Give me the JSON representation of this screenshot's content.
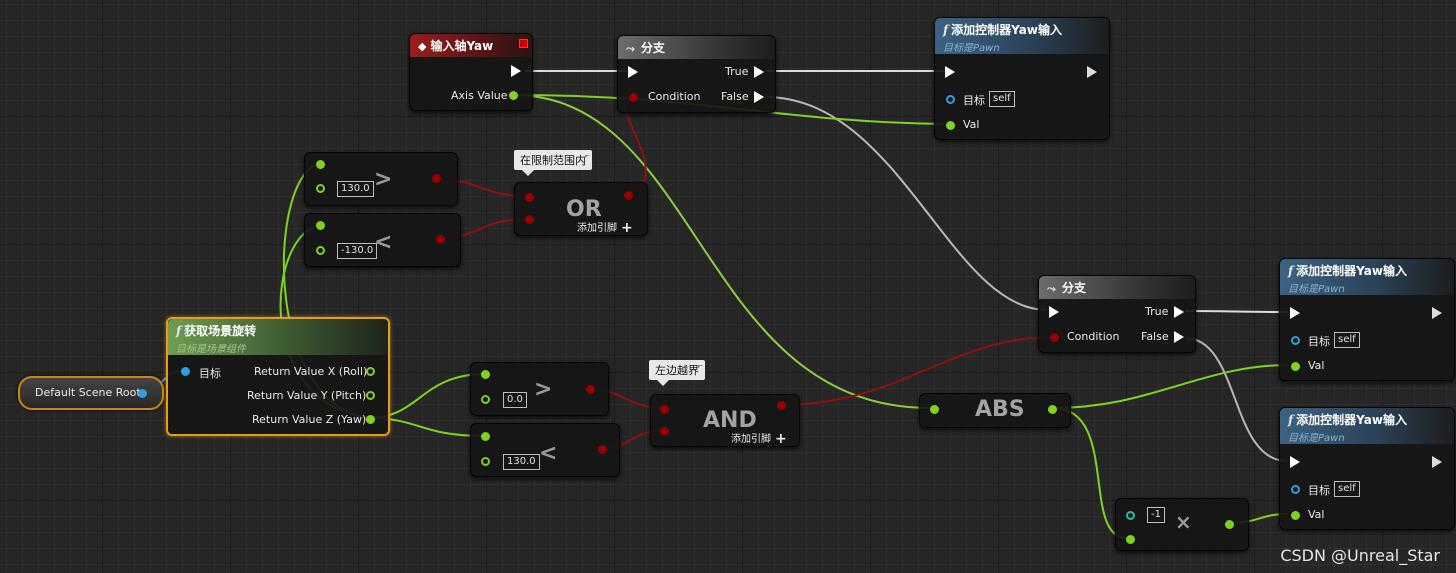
{
  "events": {
    "input_axis": {
      "title": "输入轴Yaw",
      "axis_value": "Axis Value"
    }
  },
  "branch": {
    "title": "分支",
    "condition": "Condition",
    "true": "True",
    "false": "False"
  },
  "add_yaw": {
    "title": "添加控制器Yaw输入",
    "subtitle": "目标是Pawn",
    "target": "目标",
    "self": "self",
    "val": "Val"
  },
  "get_rotation": {
    "title": "获取场景旋转",
    "subtitle": "目标是场景组件",
    "target": "目标",
    "rx": "Return Value X (Roll)",
    "ry": "Return Value Y (Pitch)",
    "rz": "Return Value Z (Yaw)"
  },
  "root_var": {
    "label": "Default Scene Root"
  },
  "compare": {
    "gt_a": "130.0",
    "lt_a": "-130.0",
    "gt_b": "0.0",
    "lt_b": "130.0",
    "gt_sym": ">",
    "lt_sym": "<"
  },
  "logic": {
    "or": "OR",
    "and": "AND",
    "add_pin": "添加引脚",
    "plus": "+"
  },
  "comments": {
    "in_range": "在限制范围内",
    "left_bound": "左边越界"
  },
  "abs": {
    "label": "ABS"
  },
  "multiply": {
    "value": "-1",
    "sym": "×"
  },
  "watermark": "CSDN @Unreal_Star",
  "colors": {
    "float_pin": "#7ed321",
    "bool_pin": "#960000",
    "object_pin": "#2f9fe0",
    "int_pin": "#1fbfa8",
    "exec_pin": "#ffffff",
    "selection": "#e89c1e"
  },
  "icons": {
    "event": "event-diamond-icon",
    "branch": "branch-icon",
    "function": "function-icon",
    "delegate": "delegate-square-icon",
    "comment": "comment-bubble-icon"
  }
}
